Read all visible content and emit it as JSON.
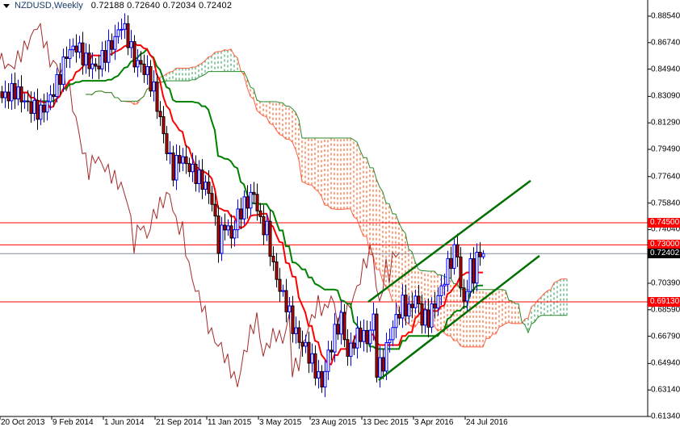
{
  "header": {
    "symbol": "NZDUSD,Weekly",
    "ohlc": "0.72188 0.72640 0.72034 0.72402"
  },
  "chart_data": {
    "type": "candlestick",
    "title": "NZDUSD,Weekly",
    "indicator": "Ichimoku Kinko Hyo",
    "last_bar": {
      "open": 0.72188,
      "high": 0.7264,
      "low": 0.72034,
      "close": 0.72402
    },
    "ylim": [
      0.6134,
      0.8854
    ],
    "y_ticks": [
      "0.88540",
      "0.86740",
      "0.84940",
      "0.83090",
      "0.81290",
      "0.79490",
      "0.77640",
      "0.75840",
      "0.74040",
      "0.70390",
      "0.68590",
      "0.66790",
      "0.64940",
      "0.63140",
      "0.61340"
    ],
    "x_ticks": [
      {
        "label": "20 Oct 2013",
        "week": 0
      },
      {
        "label": "9 Feb 2014",
        "week": 16
      },
      {
        "label": "1 Jun 2014",
        "week": 32
      },
      {
        "label": "21 Sep 2014",
        "week": 48
      },
      {
        "label": "11 Jan 2015",
        "week": 64
      },
      {
        "label": "3 May 2015",
        "week": 80
      },
      {
        "label": "23 Aug 2015",
        "week": 96
      },
      {
        "label": "13 Dec 2015",
        "week": 112
      },
      {
        "label": "3 Apr 2016",
        "week": 128
      },
      {
        "label": "24 Jul 2016",
        "week": 144
      }
    ],
    "close_keypoints": [
      [
        0,
        0.83
      ],
      [
        4,
        0.835
      ],
      [
        8,
        0.825
      ],
      [
        12,
        0.82
      ],
      [
        15,
        0.83
      ],
      [
        18,
        0.845
      ],
      [
        20,
        0.86
      ],
      [
        23,
        0.865
      ],
      [
        26,
        0.855
      ],
      [
        29,
        0.85
      ],
      [
        32,
        0.86
      ],
      [
        35,
        0.87
      ],
      [
        37,
        0.88
      ],
      [
        39,
        0.87
      ],
      [
        41,
        0.855
      ],
      [
        43,
        0.852
      ],
      [
        45,
        0.846
      ],
      [
        47,
        0.835
      ],
      [
        49,
        0.815
      ],
      [
        51,
        0.795
      ],
      [
        53,
        0.78
      ],
      [
        55,
        0.79
      ],
      [
        57,
        0.785
      ],
      [
        59,
        0.78
      ],
      [
        61,
        0.775
      ],
      [
        63,
        0.77
      ],
      [
        65,
        0.76
      ],
      [
        67,
        0.73
      ],
      [
        69,
        0.745
      ],
      [
        71,
        0.735
      ],
      [
        73,
        0.75
      ],
      [
        76,
        0.76
      ],
      [
        78,
        0.765
      ],
      [
        80,
        0.745
      ],
      [
        82,
        0.74
      ],
      [
        84,
        0.715
      ],
      [
        86,
        0.7
      ],
      [
        88,
        0.69
      ],
      [
        90,
        0.675
      ],
      [
        92,
        0.665
      ],
      [
        94,
        0.66
      ],
      [
        96,
        0.65
      ],
      [
        98,
        0.64
      ],
      [
        99,
        0.635
      ],
      [
        101,
        0.655
      ],
      [
        103,
        0.67
      ],
      [
        105,
        0.68
      ],
      [
        107,
        0.655
      ],
      [
        109,
        0.665
      ],
      [
        111,
        0.67
      ],
      [
        113,
        0.665
      ],
      [
        115,
        0.68
      ],
      [
        116,
        0.645
      ],
      [
        118,
        0.65
      ],
      [
        120,
        0.668
      ],
      [
        122,
        0.68
      ],
      [
        124,
        0.69
      ],
      [
        126,
        0.685
      ],
      [
        128,
        0.695
      ],
      [
        130,
        0.68
      ],
      [
        132,
        0.68
      ],
      [
        134,
        0.69
      ],
      [
        136,
        0.7
      ],
      [
        138,
        0.715
      ],
      [
        140,
        0.725
      ],
      [
        141,
        0.725
      ],
      [
        142,
        0.7
      ],
      [
        143,
        0.69
      ],
      [
        145,
        0.715
      ],
      [
        146,
        0.71
      ],
      [
        147,
        0.725
      ],
      [
        148,
        0.72188
      ],
      [
        149,
        0.72402
      ]
    ],
    "horizontal_levels": [
      {
        "price": 0.745,
        "label": "0.74500",
        "color": "#ff0000"
      },
      {
        "price": 0.73,
        "label": "0.73000",
        "color": "#ff0000"
      },
      {
        "price": 0.72402,
        "label": "0.72402",
        "color": "#808a99",
        "current": true
      },
      {
        "price": 0.6913,
        "label": "0.69130",
        "color": "#ff0000"
      }
    ],
    "trendlines": [
      {
        "name": "channel-upper",
        "from": [
          113.5,
          0.6913
        ],
        "to": [
          163.75,
          0.7736
        ],
        "color": "#007000"
      },
      {
        "name": "channel-lower",
        "from": [
          116.75,
          0.6381
        ],
        "to": [
          166.5,
          0.7226
        ],
        "color": "#007000"
      }
    ],
    "colors": {
      "bull": "#0000ff",
      "bear_fill": "#cc0000",
      "tenkan": "#ff0000",
      "kijun": "#008000",
      "chikou": "#a52a2a",
      "cloud_bear": "#ff4500",
      "cloud_bull": "#1e9e50"
    }
  }
}
